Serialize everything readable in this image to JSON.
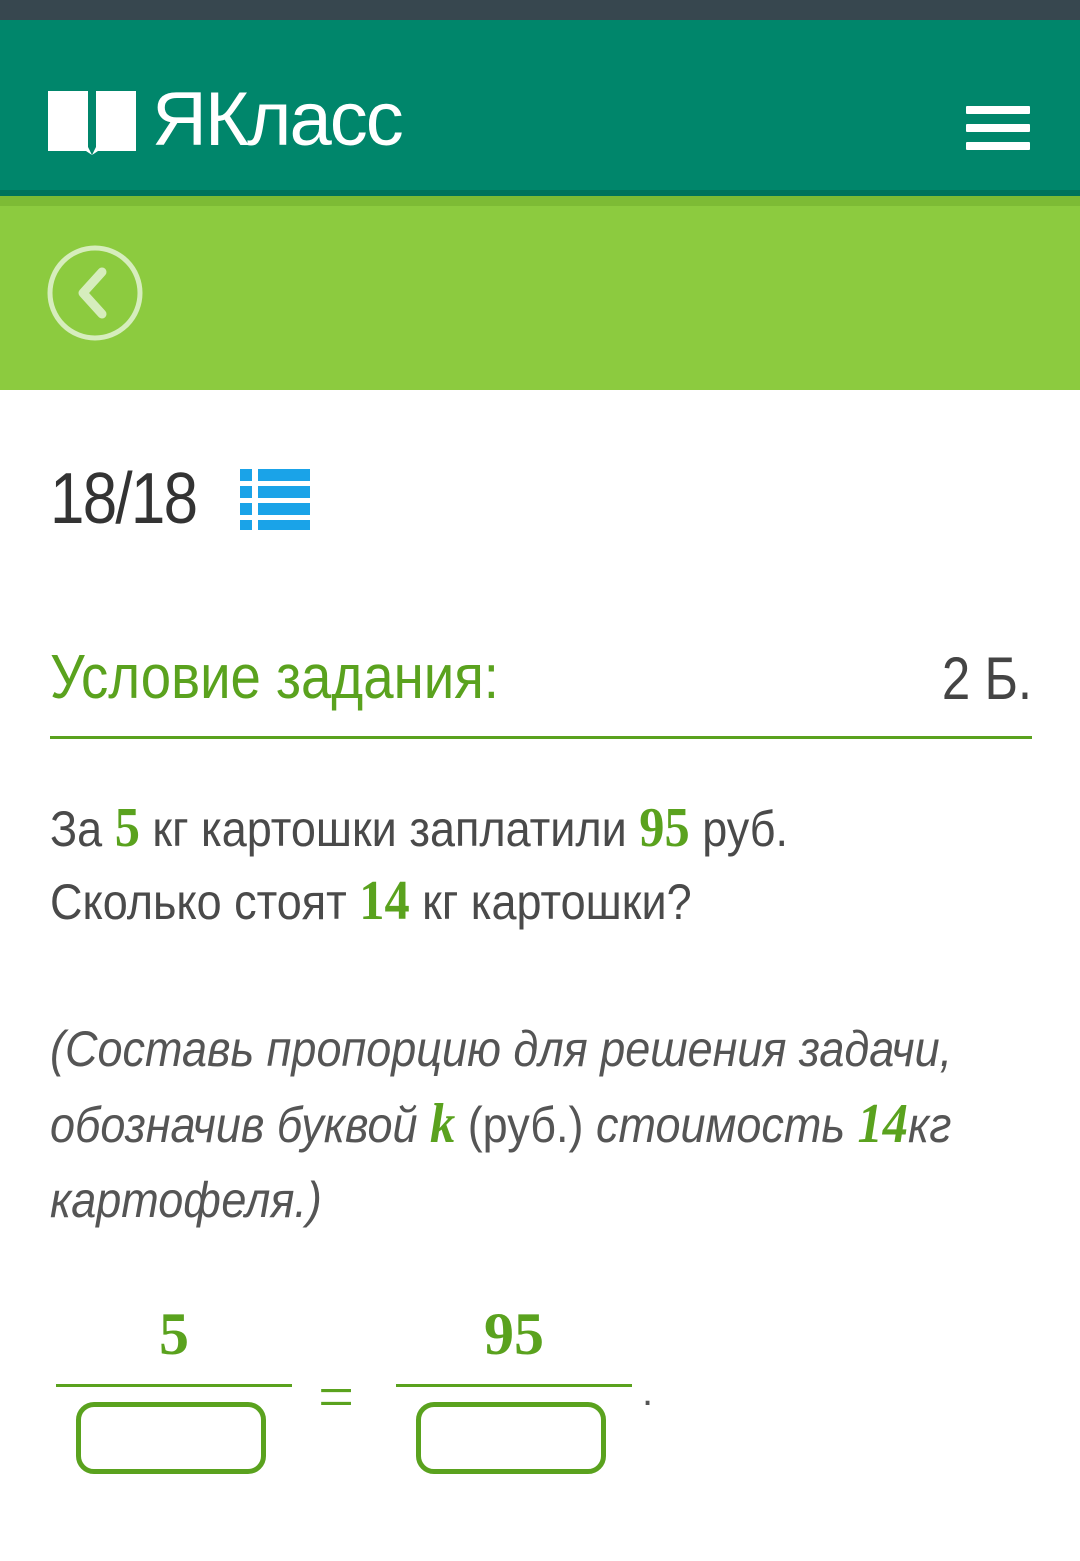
{
  "app": {
    "name": "ЯКласс"
  },
  "header": {
    "logo_text": "ЯКласс",
    "menu_icon": "hamburger-menu-icon",
    "back_icon": "back-arrow-icon"
  },
  "colors": {
    "header_bg": "#00866b",
    "subbar_bg": "#8ccb3f",
    "accent_green": "#5aa21e",
    "list_icon": "#1aa3e8"
  },
  "progress": {
    "current": "18",
    "total": "18",
    "display": "18/18",
    "list_icon": "list-icon"
  },
  "task": {
    "section_title": "Условие задания:",
    "points": "2 Б.",
    "line1": {
      "a": "За ",
      "n1": "5",
      "b": " кг картошки заплатили ",
      "n2": "95",
      "c": " руб."
    },
    "line2": {
      "a": "Сколько стоят ",
      "n1": "14",
      "b": " кг картошки?"
    },
    "hint": {
      "line1": "(Составь пропорцию для решения задачи,",
      "line2_a": "обозначив буквой ",
      "var": "k",
      "line2_b": " (руб.)",
      "line2_c": " стоимость ",
      "num": "14",
      "line2_d": "кг",
      "line3": "картофеля.)"
    }
  },
  "equation": {
    "left_numerator": "5",
    "right_numerator": "95",
    "equals": "=",
    "end": ".",
    "left_denominator_value": "",
    "right_denominator_value": ""
  }
}
